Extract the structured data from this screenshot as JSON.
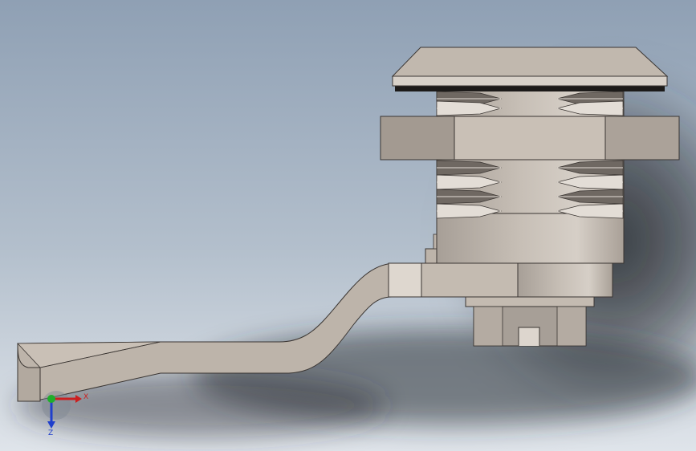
{
  "viewport": {
    "background_top": "#8fa0b4",
    "background_mid": "#b3bfcc",
    "background_bottom": "#dfe4ea",
    "shadow_color": "#2c2f33"
  },
  "part": {
    "body_color": "#bdb4aa",
    "face_light": "#c9c0b6",
    "face_dark": "#9a9188",
    "edge_color": "#3a3532",
    "thread_dark": "#6f6862",
    "thread_light": "#e3ddd6"
  },
  "triad": {
    "x_label": "X",
    "z_label": "Z",
    "x_color": "#cc1f1f",
    "y_color": "#1fae2a",
    "z_color": "#1f3fcc"
  }
}
